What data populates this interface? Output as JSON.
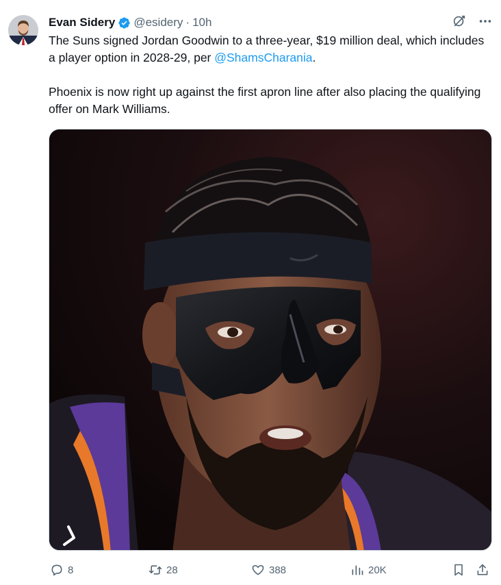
{
  "author": {
    "name": "Evan Sidery",
    "handle": "@esidery",
    "separator": "·",
    "time": "10h",
    "verified": true,
    "avatar_icon": "avatar-photo"
  },
  "tweet": {
    "line1_text": "The Suns signed Jordan Goodwin to a three-year, $19 million deal, which includes a player option in 2028-29, per ",
    "mention": "@ShamsCharania",
    "line1_end": ".",
    "paragraph2": "Phoenix is now right up against the first apron line after also placing the qualifying offer on Mark Williams."
  },
  "media": {
    "alt": "basketball player wearing black carbon face mask and headband"
  },
  "actions": {
    "replies": "8",
    "retweets": "28",
    "likes": "388",
    "views": "20K"
  },
  "colors": {
    "text": "#0f1419",
    "secondary": "#536471",
    "link": "#1d9bf0",
    "verified": "#1d9bf0"
  }
}
